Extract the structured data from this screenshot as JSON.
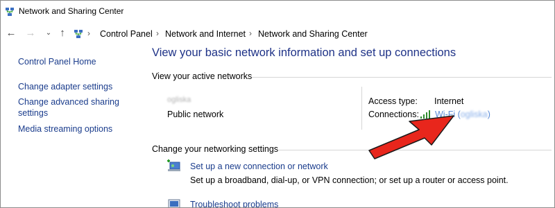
{
  "window": {
    "title": "Network and Sharing Center"
  },
  "address_bar": {
    "crumbs": [
      "Control Panel",
      "Network and Internet",
      "Network and Sharing Center"
    ]
  },
  "left_panel": {
    "links": [
      {
        "label": "Control Panel Home"
      },
      {
        "label": "Change adapter settings"
      },
      {
        "label": "Change advanced sharing settings"
      },
      {
        "label": "Media streaming options"
      }
    ]
  },
  "main": {
    "heading": "View your basic network information and set up connections",
    "active_networks": {
      "title": "View your active networks",
      "network_name": "ogliska",
      "network_type": "Public network",
      "access_type_label": "Access type:",
      "access_type_value": "Internet",
      "connections_label": "Connections:",
      "connection_prefix": "Wi-Fi (",
      "connection_name": "ogliska",
      "connection_suffix": ")"
    },
    "change_settings": {
      "title": "Change your networking settings",
      "tasks": [
        {
          "label": "Set up a new connection or network",
          "description": "Set up a broadband, dial-up, or VPN connection; or set up a router or access point."
        },
        {
          "label": "Troubleshoot problems",
          "description": ""
        }
      ]
    }
  },
  "colors": {
    "link": "#1a3c8c",
    "heading": "#1e3287",
    "arrow": "#e8261c",
    "wifi": "#5a8ad6"
  },
  "icons": [
    "network-icon",
    "back-icon",
    "forward-icon",
    "recent-chevron-icon",
    "up-icon",
    "wifi-signal-icon",
    "new-connection-icon",
    "troubleshoot-icon",
    "red-arrow-annotation"
  ]
}
